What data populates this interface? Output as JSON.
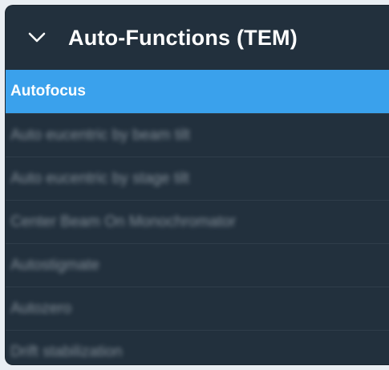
{
  "header": {
    "title": "Auto-Functions (TEM)",
    "toggle_icon": "chevron-down-icon"
  },
  "list": {
    "items": [
      {
        "label": "Autofocus",
        "selected": true
      },
      {
        "label": "Auto eucentric by beam tilt",
        "selected": false
      },
      {
        "label": "Auto eucentric by stage tilt",
        "selected": false
      },
      {
        "label": "Center Beam On Monochromator",
        "selected": false
      },
      {
        "label": "Autostigmate",
        "selected": false
      },
      {
        "label": "Autozero",
        "selected": false
      },
      {
        "label": "Drift stabilization",
        "selected": false
      }
    ]
  },
  "colors": {
    "panel_bg": "#22303d",
    "selected_bg": "#3aa1ec",
    "page_bg": "#e9eef3"
  }
}
